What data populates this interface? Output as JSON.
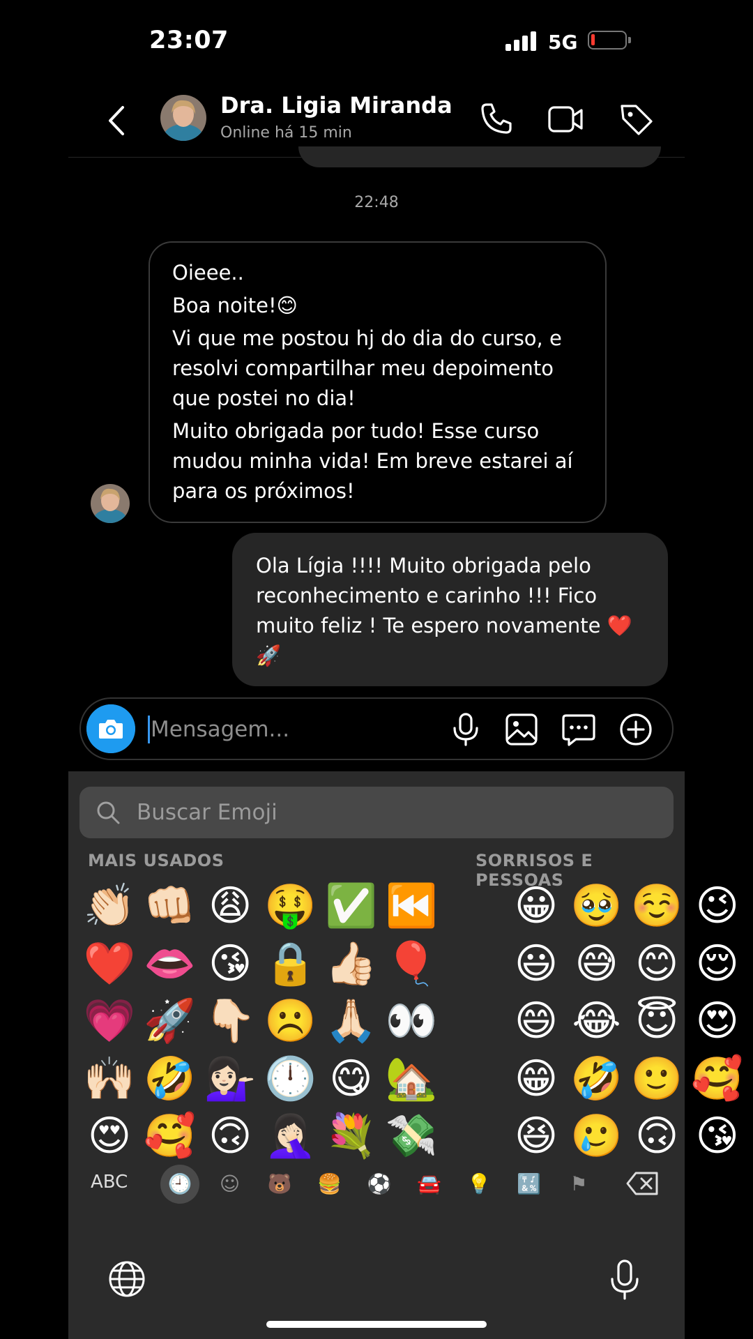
{
  "status_bar": {
    "time": "23:07",
    "network": "5G",
    "battery_level": 0.1,
    "battery_color": "#ff3b30"
  },
  "header": {
    "contact_name": "Dra. Ligia Miranda",
    "presence": "Online há 15 min",
    "icons": [
      "back-chevron-icon",
      "phone-icon",
      "video-camera-icon",
      "tag-icon"
    ]
  },
  "chat": {
    "timestamp": "22:48",
    "incoming_message": [
      "Oieee..",
      "Boa noite!😊",
      "Vi que me postou hj do dia do curso, e resolvi compartilhar meu depoimento que postei no dia!",
      "Muito obrigada por tudo! Esse curso mudou minha vida! Em breve estarei aí para os próximos!"
    ],
    "outgoing_message": "Ola Lígia !!!! Muito obrigada pelo reconhecimento e carinho !!! Fico muito feliz ! Te espero novamente ❤️🚀"
  },
  "composer": {
    "placeholder": "Mensagem...",
    "accent_color": "#1e9bf0",
    "icons": [
      "camera-icon",
      "microphone-icon",
      "gallery-icon",
      "sticker-chat-icon",
      "plus-icon"
    ]
  },
  "keyboard": {
    "search_placeholder": "Buscar Emoji",
    "section_frequent": "MAIS USADOS",
    "section_smileys": "SORRISOS E PESSOAS",
    "frequent": [
      [
        "👏🏻",
        "👊🏻",
        "😩",
        "🤑",
        "✅",
        "⏮️"
      ],
      [
        "❤️",
        "👄",
        "😘",
        "🔒",
        "👍🏻",
        "🎈"
      ],
      [
        "💗",
        "🚀",
        "👇🏻",
        "☹️",
        "🙏🏻",
        "👀"
      ],
      [
        "🙌🏻",
        "🤣",
        "💁🏻‍♀️",
        "🕛",
        "😋",
        "🏡"
      ],
      [
        "😍",
        "🥰",
        "🙃",
        "🤦🏻‍♀️",
        "💐",
        "💸"
      ]
    ],
    "smileys": [
      [
        "😀",
        "🥹",
        "☺️",
        "😉"
      ],
      [
        "😃",
        "😅",
        "😊",
        "😌"
      ],
      [
        "😄",
        "😂",
        "😇",
        "😍"
      ],
      [
        "😁",
        "🤣",
        "🙂",
        "🥰"
      ],
      [
        "😆",
        "🥲",
        "🙃",
        "😘"
      ]
    ],
    "abc_label": "ABC",
    "categories": [
      "🕘",
      "☺",
      "🐻",
      "🍔",
      "⚽",
      "🚘",
      "💡",
      "🔣",
      "⚑"
    ],
    "active_category": 0
  }
}
